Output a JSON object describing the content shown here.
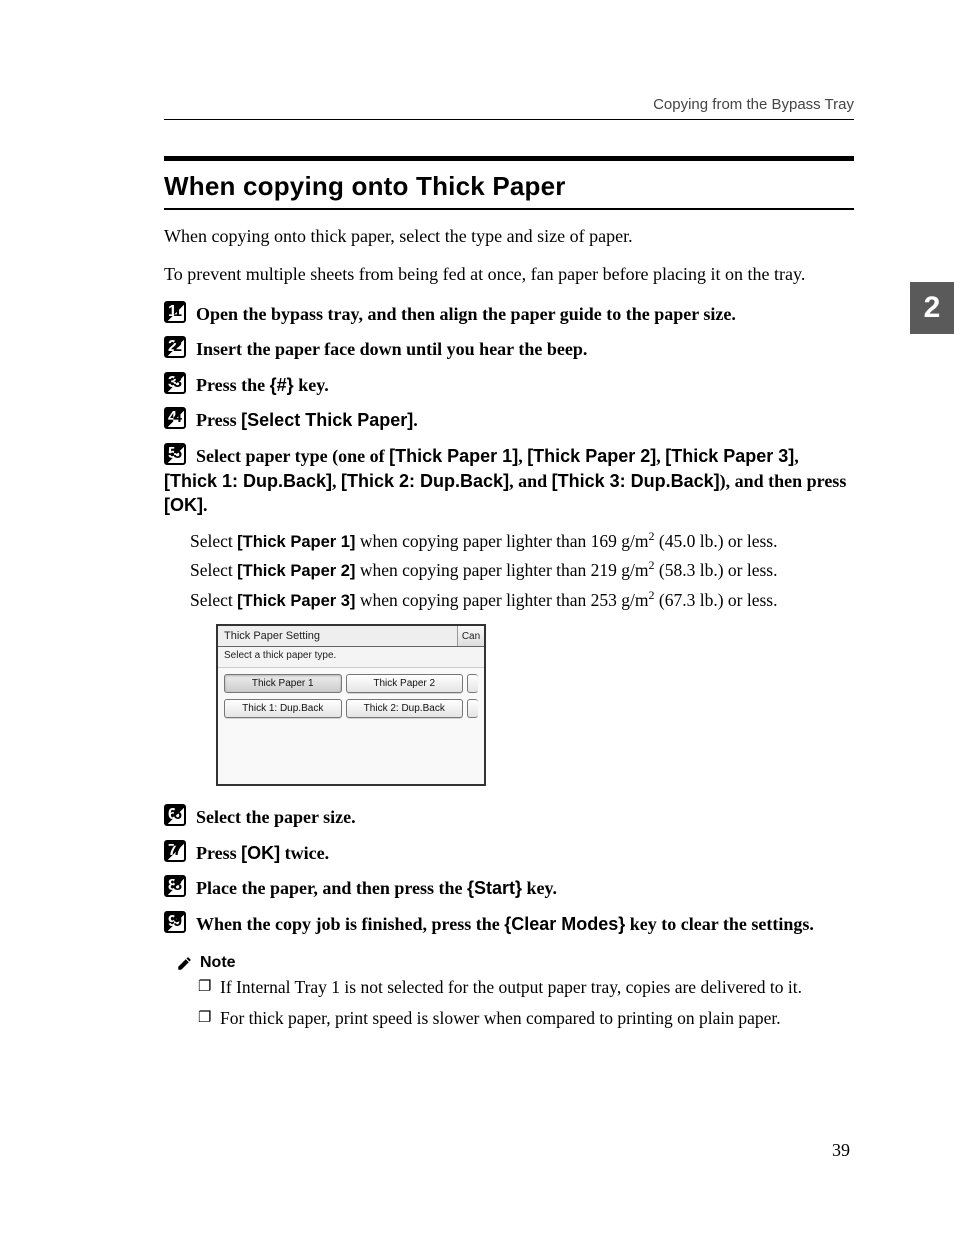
{
  "header": {
    "running": "Copying from the Bypass Tray"
  },
  "thumb_tab": "2",
  "title": "When copying onto Thick Paper",
  "intro": {
    "p1": "When copying onto thick paper, select the type and size of paper.",
    "p2": "To prevent multiple sheets from being fed at once, fan paper before placing it on the tray."
  },
  "steps": {
    "s1_num": "1",
    "s1": "Open the bypass tray, and then align the paper guide to the paper size.",
    "s2_num": "2",
    "s2": "Insert the paper face down until you hear the beep.",
    "s3_num": "3",
    "s3_pre": "Press the ",
    "s3_key": "{#}",
    "s3_post": " key.",
    "s4_num": "4",
    "s4_pre": "Press ",
    "s4_btn": "[Select Thick Paper]",
    "s4_post": ".",
    "s5_num": "5",
    "s5_pre": "Select paper type (one of ",
    "s5_b1": "[Thick Paper 1]",
    "s5_sep": ", ",
    "s5_b2": "[Thick Paper 2]",
    "s5_b3": "[Thick Paper 3]",
    "s5_b4": "[Thick 1: Dup.Back]",
    "s5_b5": "[Thick 2: Dup.Back]",
    "s5_mid": ", and ",
    "s5_b6": "[Thick 3: Dup.Back]",
    "s5_mid2": "), and then press ",
    "s5_ok": "[OK]",
    "s5_post": ".",
    "tp1_pre": "Select ",
    "tp1_lbl": "[Thick Paper 1]",
    "tp1_post": " when copying paper lighter than 169 g/m",
    "tp1_sup": "2",
    "tp1_tail": " (45.0 lb.) or less.",
    "tp2_pre": "Select ",
    "tp2_lbl": "[Thick Paper 2]",
    "tp2_post": " when copying paper lighter than 219 g/m",
    "tp2_sup": "2",
    "tp2_tail": " (58.3 lb.) or less.",
    "tp3_pre": "Select ",
    "tp3_lbl": "[Thick Paper 3]",
    "tp3_post": " when copying paper lighter than 253 g/m",
    "tp3_sup": "2",
    "tp3_tail": " (67.3 lb.) or less.",
    "s6_num": "6",
    "s6": "Select the paper size.",
    "s7_num": "7",
    "s7_pre": "Press ",
    "s7_btn": "[OK]",
    "s7_post": " twice.",
    "s8_num": "8",
    "s8_pre": "Place the paper, and then press the ",
    "s8_key": "{Start}",
    "s8_post": " key.",
    "s9_num": "9",
    "s9_pre": "When the copy job is finished, press the ",
    "s9_key": "{Clear Modes}",
    "s9_post": " key to clear the settings."
  },
  "lcd": {
    "title": "Thick Paper Setting",
    "cancel": "Can",
    "instruction": "Select a thick paper type.",
    "btn1": "Thick Paper 1",
    "btn2": "Thick Paper 2",
    "btn3": "Thick 1: Dup.Back",
    "btn4": "Thick 2: Dup.Back"
  },
  "note": {
    "label": "Note",
    "items": {
      "n1": "If Internal Tray 1 is not selected for the output paper tray, copies are delivered to it.",
      "n2": "For thick paper, print speed is slower when compared to printing on plain paper."
    }
  },
  "page_number": "39"
}
